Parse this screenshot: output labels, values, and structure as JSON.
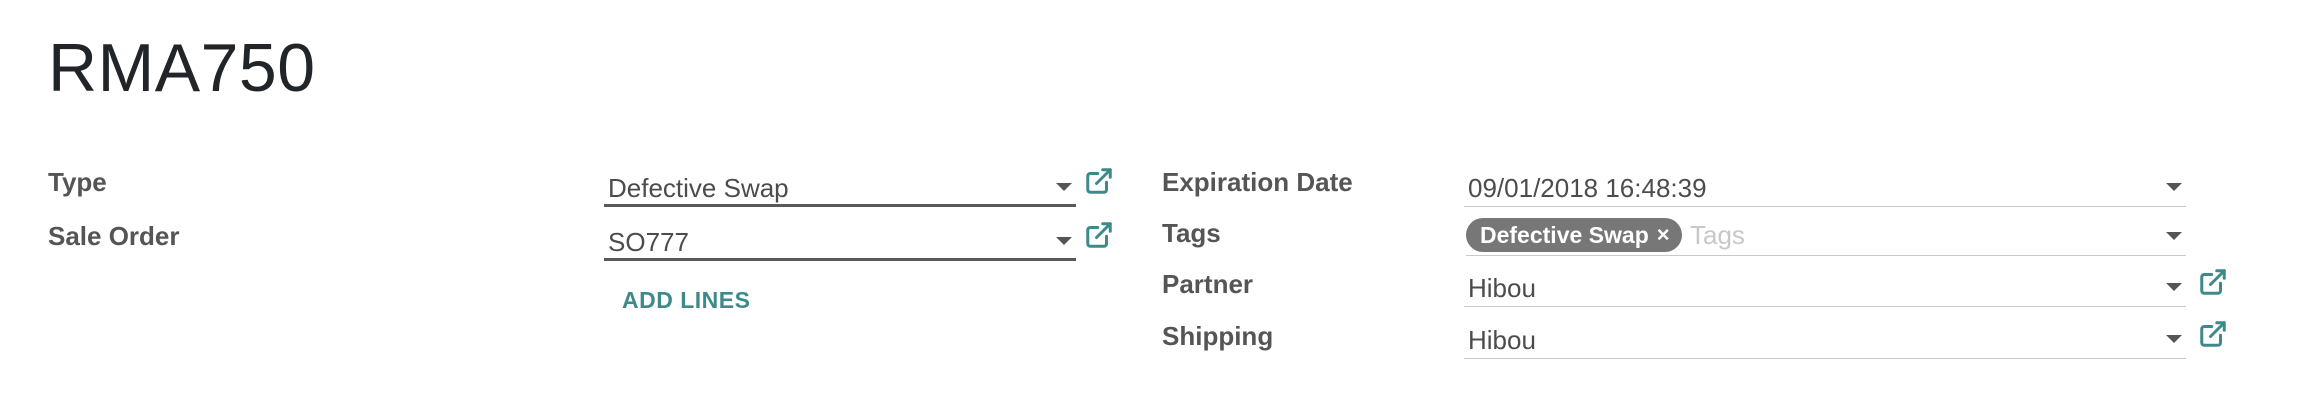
{
  "record": {
    "title": "RMA750"
  },
  "left_fields": {
    "type": {
      "label": "Type",
      "value": "Defective Swap"
    },
    "sale_order": {
      "label": "Sale Order",
      "value": "SO777"
    },
    "add_lines_label": "ADD LINES"
  },
  "right_fields": {
    "expiration_date": {
      "label": "Expiration Date",
      "value": "09/01/2018 16:48:39"
    },
    "tags": {
      "label": "Tags",
      "items": [
        {
          "label": "Defective Swap",
          "remove_icon": "×"
        }
      ],
      "placeholder": "Tags"
    },
    "partner": {
      "label": "Partner",
      "value": "Hibou"
    },
    "shipping": {
      "label": "Shipping",
      "value": "Hibou"
    }
  },
  "icons": {
    "dropdown": "caret-down-icon",
    "external_link": "external-link-icon",
    "remove": "close-icon"
  },
  "colors": {
    "link_teal": "#3e8a8a",
    "tag_badge": "#777777",
    "label_text": "#555555",
    "title_text": "#212529"
  }
}
